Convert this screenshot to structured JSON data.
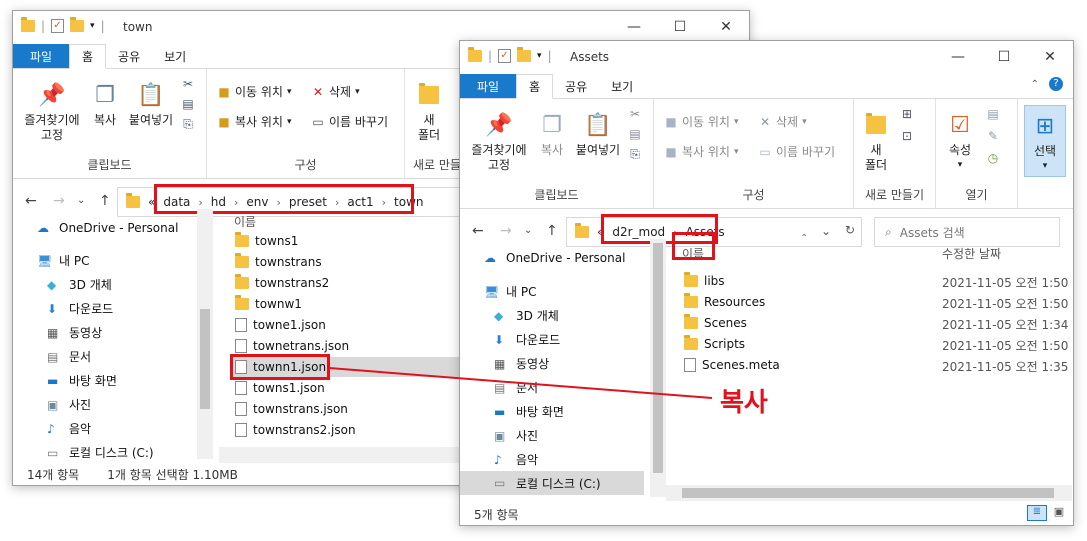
{
  "window1": {
    "title": "town",
    "tabs": [
      "파일",
      "홈",
      "공유",
      "보기"
    ],
    "ribbon": {
      "pin": "즐겨찾기에 고정",
      "copy": "복사",
      "paste": "붙여넣기",
      "clipboard_group": "클립보드",
      "move_to": "이동 위치",
      "copy_to": "복사 위치",
      "delete": "삭제",
      "rename": "이름 바꾸기",
      "organize_group": "구성",
      "new_folder": "새 폴더",
      "new_group": "새로 만들"
    },
    "address": {
      "prefix": "«",
      "crumbs": [
        "data",
        "hd",
        "env",
        "preset",
        "act1",
        "town"
      ]
    },
    "nav": [
      "OneDrive - Personal",
      "내 PC",
      "3D 개체",
      "다운로드",
      "동영상",
      "문서",
      "바탕 화면",
      "사진",
      "음악",
      "로컬 디스크 (C:)"
    ],
    "column_name": "이름",
    "files": [
      {
        "name": "towns1",
        "type": "folder"
      },
      {
        "name": "townstrans",
        "type": "folder"
      },
      {
        "name": "townstrans2",
        "type": "folder"
      },
      {
        "name": "townw1",
        "type": "folder"
      },
      {
        "name": "towne1.json",
        "type": "file"
      },
      {
        "name": "townetrans.json",
        "type": "file"
      },
      {
        "name": "townn1.json",
        "type": "file",
        "selected": true
      },
      {
        "name": "towns1.json",
        "type": "file"
      },
      {
        "name": "townstrans.json",
        "type": "file"
      },
      {
        "name": "townstrans2.json",
        "type": "file"
      }
    ],
    "status": {
      "count": "14개 항목",
      "selection": "1개 항목 선택함 1.10MB"
    }
  },
  "window2": {
    "title": "Assets",
    "tabs": [
      "파일",
      "홈",
      "공유",
      "보기"
    ],
    "ribbon": {
      "pin": "즐겨찾기에 고정",
      "copy": "복사",
      "paste": "붙여넣기",
      "clipboard_group": "클립보드",
      "move_to": "이동 위치",
      "copy_to": "복사 위치",
      "delete": "삭제",
      "rename": "이름 바꾸기",
      "organize_group": "구성",
      "new_folder": "새 폴더",
      "new_group": "새로 만들기",
      "properties": "속성",
      "open_group": "열기",
      "select": "선택"
    },
    "address": {
      "prefix": "«",
      "crumbs": [
        "d2r_mod",
        "Assets"
      ]
    },
    "search_placeholder": "Assets 검색",
    "nav": [
      "OneDrive - Personal",
      "내 PC",
      "3D 개체",
      "다운로드",
      "동영상",
      "문서",
      "바탕 화면",
      "사진",
      "음악",
      "로컬 디스크 (C:)"
    ],
    "column_name": "이름",
    "column_date": "수정한 날짜",
    "files": [
      {
        "name": "libs",
        "type": "folder",
        "date": "2021-11-05 오전 1:50"
      },
      {
        "name": "Resources",
        "type": "folder",
        "date": "2021-11-05 오전 1:50"
      },
      {
        "name": "Scenes",
        "type": "folder",
        "date": "2021-11-05 오전 1:34"
      },
      {
        "name": "Scripts",
        "type": "folder",
        "date": "2021-11-05 오전 1:50"
      },
      {
        "name": "Scenes.meta",
        "type": "file",
        "date": "2021-11-05 오전 1:35"
      }
    ],
    "status": {
      "count": "5개 항목"
    }
  },
  "annotation": {
    "label": "복사",
    "color": "#e0121b"
  }
}
